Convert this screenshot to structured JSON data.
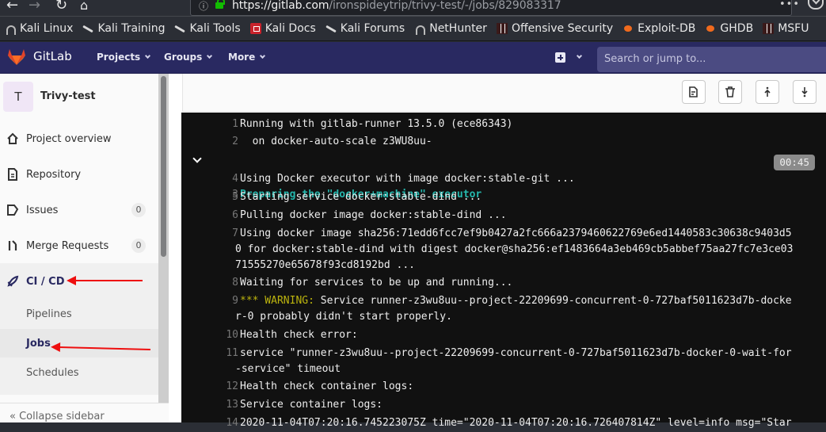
{
  "browser": {
    "url_host": "https://gitlab.com",
    "url_path": "/ironspideytrip/trivy-test/-/jobs/829083317",
    "bookmarks": [
      {
        "label": "Kali Linux",
        "icon": "kali-arch-icon"
      },
      {
        "label": "Kali Training",
        "icon": "kali-dragon-icon"
      },
      {
        "label": "Kali Tools",
        "icon": "kali-dragon-icon"
      },
      {
        "label": "Kali Docs",
        "icon": "kali-docs-icon"
      },
      {
        "label": "Kali Forums",
        "icon": "kali-dragon-icon"
      },
      {
        "label": "NetHunter",
        "icon": "kali-arch-icon"
      },
      {
        "label": "Offensive Security",
        "icon": "offsec-icon"
      },
      {
        "label": "Exploit-DB",
        "icon": "exploitdb-bug-icon"
      },
      {
        "label": "GHDB",
        "icon": "exploitdb-bug-icon"
      },
      {
        "label": "MSFU",
        "icon": "offsec-icon"
      }
    ]
  },
  "header": {
    "brand": "GitLab",
    "nav": [
      "Projects",
      "Groups",
      "More"
    ],
    "search_placeholder": "Search or jump to..."
  },
  "sidebar": {
    "project_initial": "T",
    "project_name": "Trivy-test",
    "items": [
      {
        "label": "Project overview",
        "icon": "home-icon"
      },
      {
        "label": "Repository",
        "icon": "document-icon"
      },
      {
        "label": "Issues",
        "icon": "issues-icon",
        "count": "0"
      },
      {
        "label": "Merge Requests",
        "icon": "merge-request-icon",
        "count": "0"
      },
      {
        "label": "CI / CD",
        "icon": "rocket-icon"
      }
    ],
    "cicd_sub": [
      "Pipelines",
      "Jobs",
      "Schedules"
    ],
    "collapse_label": "Collapse sidebar"
  },
  "job_log": {
    "section_duration": "00:45",
    "lines": [
      {
        "n": "1",
        "text": "Running with gitlab-runner 13.5.0 (ece86343)"
      },
      {
        "n": "2",
        "text": "  on docker-auto-scale z3WU8uu-"
      },
      {
        "n": "3",
        "text": "Preparing the \"docker+machine\" executor"
      },
      {
        "n": "4",
        "text": "Using Docker executor with image docker:stable-git ..."
      },
      {
        "n": "5",
        "text": "Starting service docker:stable-dind ..."
      },
      {
        "n": "6",
        "text": "Pulling docker image docker:stable-dind ..."
      },
      {
        "n": "7",
        "text": "Using docker image sha256:71edd6fcc7ef9b0427a2fc666a2379460622769e6ed1440583c30638c9403d5",
        "cont": [
          "0 for docker:stable-dind with digest docker@sha256:ef1483664a3eb469cb5abbef75aa27fc7e3ce03",
          "71555270e65678f93cd8192bd ..."
        ]
      },
      {
        "n": "8",
        "text": "Waiting for services to be up and running..."
      },
      {
        "n": "9",
        "warn": "*** WARNING:",
        "text": " Service runner-z3wu8uu--project-22209699-concurrent-0-727baf5011623d7b-docke",
        "cont": [
          "r-0 probably didn't start properly."
        ]
      },
      {
        "n": "10",
        "text": "Health check error:"
      },
      {
        "n": "11",
        "text": "service \"runner-z3wu8uu--project-22209699-concurrent-0-727baf5011623d7b-docker-0-wait-for",
        "cont": [
          "-service\" timeout"
        ]
      },
      {
        "n": "12",
        "text": "Health check container logs:"
      },
      {
        "n": "13",
        "text": "Service container logs:"
      },
      {
        "n": "14",
        "text": "2020-11-04T07:20:16.745223075Z time=\"2020-11-04T07:20:16.726407814Z\" level=info msg=\"Star"
      }
    ]
  }
}
